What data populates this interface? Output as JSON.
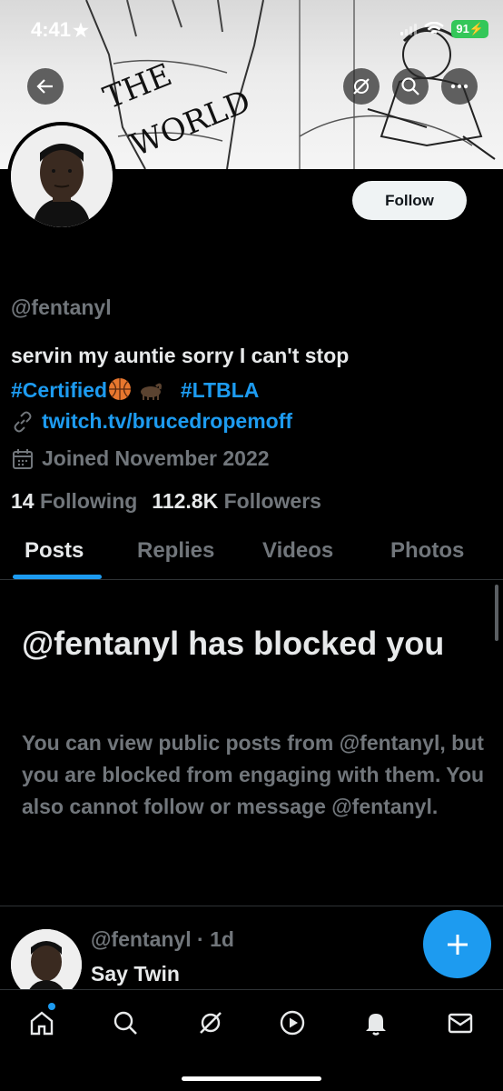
{
  "status_bar": {
    "time": "4:41",
    "battery": "91"
  },
  "profile": {
    "handle": "@fentanyl",
    "follow_label": "Follow",
    "bio_line1": "servin my auntie sorry I can't stop",
    "hashtag1": "#Certified",
    "hashtag2": "#LTBLA",
    "website": "twitch.tv/brucedropemoff",
    "joined": "Joined November 2022",
    "following_count": "14",
    "following_label": "Following",
    "followers_count": "112.8K",
    "followers_label": "Followers"
  },
  "banner_text": {
    "line1": "THE",
    "line2": "WORLD"
  },
  "tabs": [
    {
      "label": "Posts",
      "active": true
    },
    {
      "label": "Replies",
      "active": false
    },
    {
      "label": "Videos",
      "active": false
    },
    {
      "label": "Photos",
      "active": false
    }
  ],
  "blocked": {
    "title": "@fentanyl has blocked you",
    "body": "You can view public posts from @fentanyl, but you are blocked from engaging with them. You also cannot follow or message @fentanyl."
  },
  "post": {
    "handle": "@fentanyl",
    "time": "1d",
    "text": "Say Twin"
  },
  "colors": {
    "accent": "#1d9bf0",
    "background": "#000000",
    "muted": "#71767b"
  }
}
